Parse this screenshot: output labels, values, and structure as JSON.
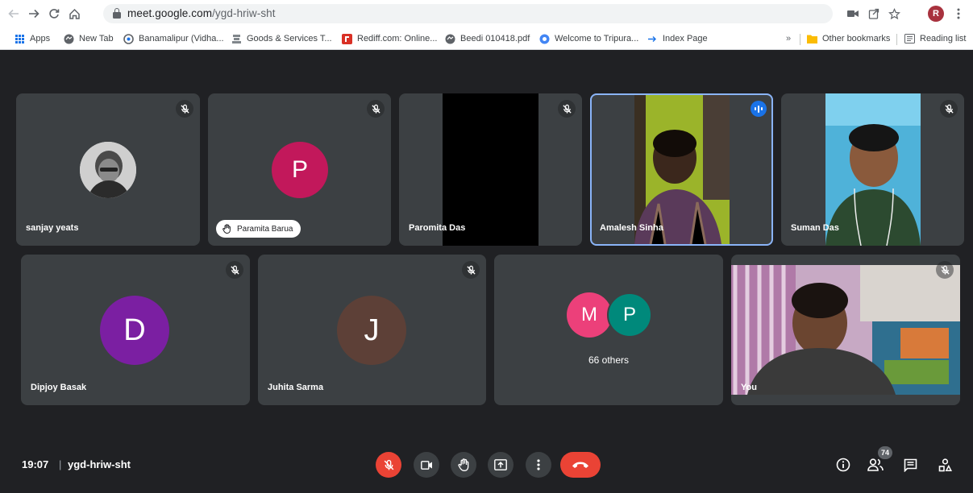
{
  "browser": {
    "url_host": "meet.google.com",
    "url_path": "/ygd-hriw-sht",
    "profile_initial": "R",
    "bookmarks": [
      {
        "label": "Apps",
        "icon": "apps-grid-icon"
      },
      {
        "label": "New Tab",
        "icon": "globe-icon"
      },
      {
        "label": "Banamalipur (Vidha...",
        "icon": "site-icon"
      },
      {
        "label": "Goods & Services T...",
        "icon": "emblem-icon"
      },
      {
        "label": "Rediff.com: Online...",
        "icon": "rediff-icon"
      },
      {
        "label": "Beedi 010418.pdf",
        "icon": "globe-icon"
      },
      {
        "label": "Welcome to Tripura...",
        "icon": "site-icon"
      },
      {
        "label": "Index Page",
        "icon": "arrow-icon"
      }
    ],
    "overflow_label": "»",
    "other_bookmarks": "Other bookmarks",
    "reading_list": "Reading list"
  },
  "participants": [
    {
      "name": "sanjay yeats",
      "type": "photo-avatar",
      "muted": true
    },
    {
      "name": "Paramita Barua",
      "type": "letter-avatar",
      "initial": "P",
      "color": "#c2185b",
      "muted": true,
      "hand_raised": true
    },
    {
      "name": "Paromita Das",
      "type": "video",
      "muted": true
    },
    {
      "name": "Amalesh Sinha",
      "type": "video",
      "speaking": true
    },
    {
      "name": "Suman Das",
      "type": "video",
      "muted": true
    },
    {
      "name": "Dipjoy Basak",
      "type": "letter-avatar",
      "initial": "D",
      "color": "#7b1fa2",
      "muted": true
    },
    {
      "name": "Juhita Sarma",
      "type": "letter-avatar",
      "initial": "J",
      "color": "#5d4037",
      "muted": true
    },
    {
      "type": "others",
      "initials": [
        "M",
        "P"
      ],
      "initial_colors": [
        "#ec407a",
        "#00897b"
      ],
      "label": "66 others"
    },
    {
      "name": "You",
      "type": "video",
      "muted": true
    }
  ],
  "bottom_bar": {
    "time": "19:07",
    "separator": "|",
    "meeting_code": "ygd-hriw-sht",
    "controls": [
      {
        "name": "mic-off-button",
        "icon": "mic-off-icon",
        "state": "off"
      },
      {
        "name": "camera-button",
        "icon": "videocam-icon"
      },
      {
        "name": "raise-hand-button",
        "icon": "hand-icon"
      },
      {
        "name": "present-button",
        "icon": "present-icon"
      },
      {
        "name": "more-options-button",
        "icon": "more-vert-icon"
      },
      {
        "name": "leave-call-button",
        "icon": "call-end-icon"
      }
    ],
    "people_count": "74"
  },
  "colors": {
    "background": "#202124",
    "tile": "#3c4043",
    "accent": "#8ab4f8",
    "danger": "#ea4335"
  }
}
